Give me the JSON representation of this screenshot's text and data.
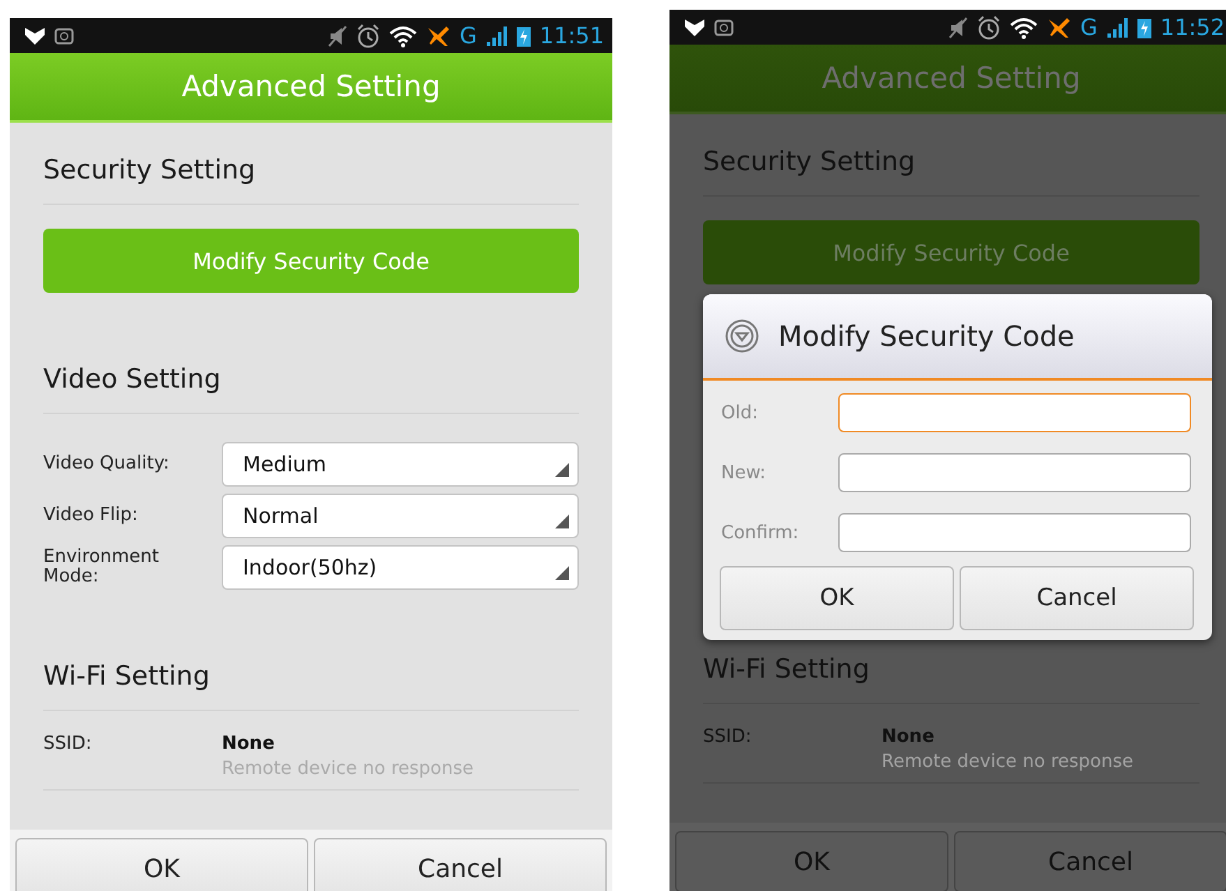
{
  "screens": [
    {
      "status_bar": {
        "network": "G",
        "time": "11:51"
      },
      "title": "Advanced Setting",
      "dimmed": false,
      "sections": [
        {
          "title": "Security Setting",
          "items": [
            {
              "kind": "button",
              "label": "Modify Security Code"
            }
          ]
        },
        {
          "title": "Video Setting",
          "items": [
            {
              "kind": "select",
              "label": "Video Quality:",
              "value": "Medium"
            },
            {
              "kind": "select",
              "label": "Video Flip:",
              "value": "Normal"
            },
            {
              "kind": "select",
              "label": "Environment Mode:",
              "value": "Indoor(50hz)"
            }
          ]
        },
        {
          "title": "Wi-Fi Setting",
          "items": [
            {
              "kind": "info",
              "label": "SSID:",
              "value": "None",
              "note": "Remote device no response"
            }
          ]
        }
      ],
      "buttons": [
        "OK",
        "Cancel"
      ]
    },
    {
      "status_bar": {
        "network": "G",
        "time": "11:52"
      },
      "title": "Advanced Setting",
      "dimmed": true,
      "sections": [
        {
          "title": "Security Setting",
          "items": [
            {
              "kind": "button",
              "label": "Modify Security Code"
            }
          ]
        },
        {
          "title": "Wi-Fi Setting",
          "items": [
            {
              "kind": "info",
              "label": "SSID:",
              "value": "None",
              "note": "Remote device no response"
            }
          ]
        }
      ],
      "buttons": [
        "OK",
        "Cancel"
      ],
      "dialog": {
        "title": "Modify Security Code",
        "fields": [
          {
            "label": "Old:",
            "focused": true
          },
          {
            "label": "New:",
            "focused": false
          },
          {
            "label": "Confirm:",
            "focused": false
          }
        ],
        "buttons": [
          "OK",
          "Cancel"
        ]
      }
    }
  ]
}
